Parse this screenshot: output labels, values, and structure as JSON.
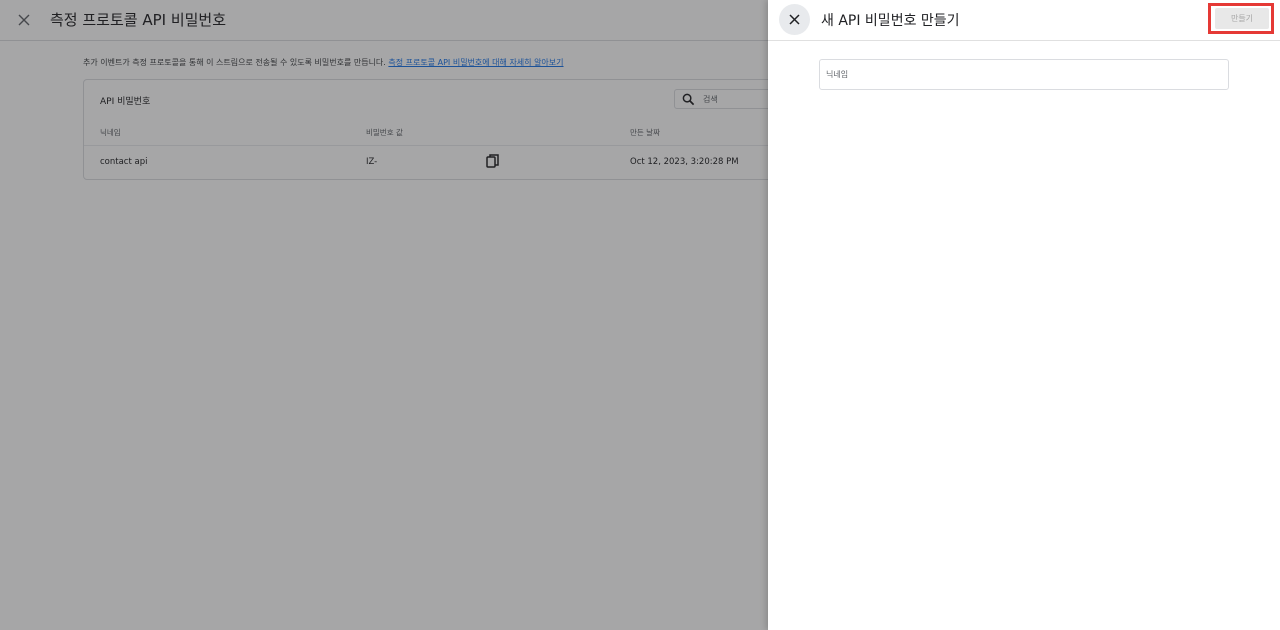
{
  "background_page": {
    "title": "측정 프로토콜 API 비밀번호",
    "description": "추가 이벤트가 측정 프로토콜을 통해 이 스트림으로 전송될 수 있도록 비밀번호를 만듭니다.",
    "learn_more_link": "측정 프로토콜 API 비밀번호에 대해 자세히 알아보기",
    "table": {
      "title": "API 비밀번호",
      "search_placeholder": "검색",
      "columns": [
        "닉네임",
        "비밀번호 값",
        "만든 날짜"
      ],
      "rows": [
        {
          "nickname": "contact api",
          "secret_value": "IZ-",
          "created": "Oct 12, 2023, 3:20:28 PM"
        }
      ]
    }
  },
  "panel": {
    "title": "새 API 비밀번호 만들기",
    "create_button": "만들기",
    "nickname_placeholder": "닉네임"
  },
  "colors": {
    "highlight": "#e53935",
    "link": "#1a73e8"
  },
  "icons": {
    "close": "close-icon",
    "search": "search-icon",
    "copy": "copy-icon"
  }
}
